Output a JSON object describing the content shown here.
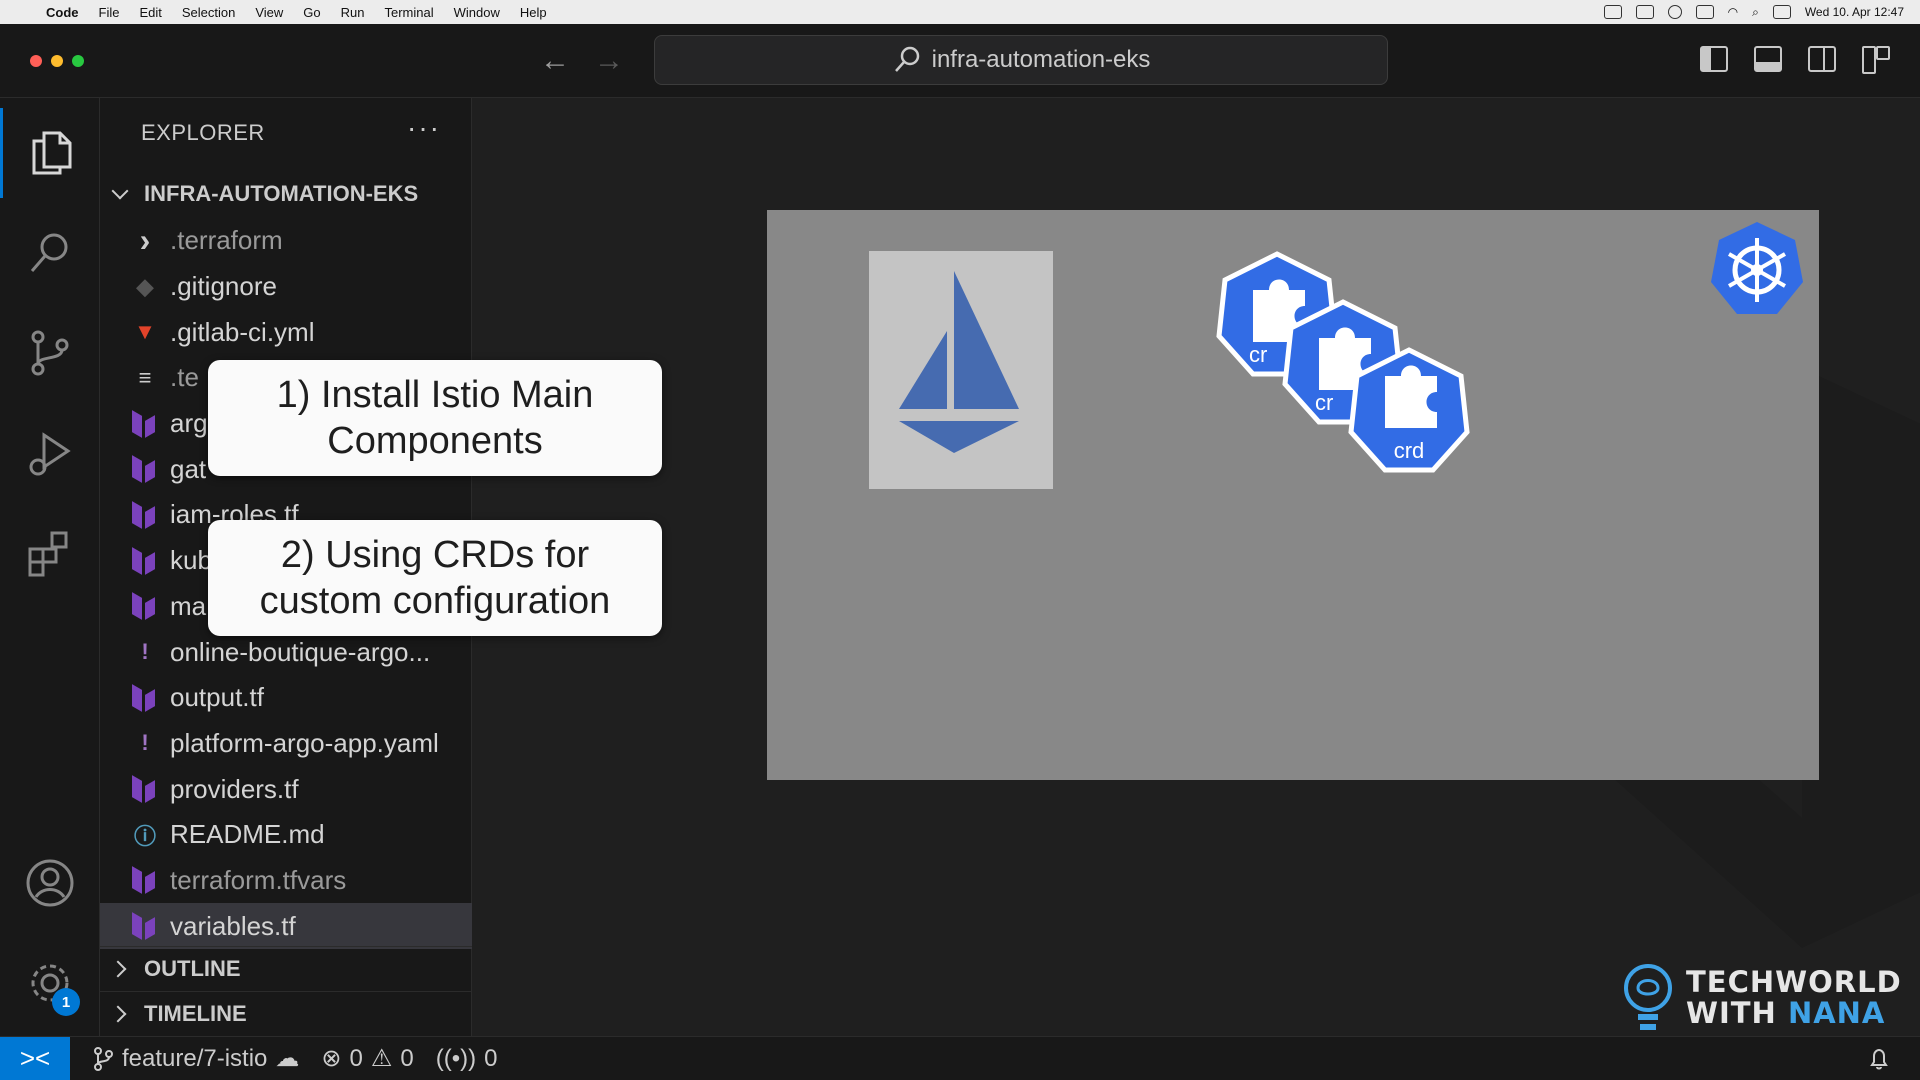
{
  "menubar": {
    "items": [
      "Code",
      "File",
      "Edit",
      "Selection",
      "View",
      "Go",
      "Run",
      "Terminal",
      "Window",
      "Help"
    ],
    "clock": "Wed 10. Apr  12:47"
  },
  "titlebar": {
    "search_text": "infra-automation-eks"
  },
  "activity": {
    "settings_badge": "1"
  },
  "explorer": {
    "title": "EXPLORER",
    "more": "···",
    "folder": "INFRA-AUTOMATION-EKS",
    "files": [
      {
        "name": ".terraform",
        "icon": "chevron-right",
        "dim": true
      },
      {
        "name": ".gitignore",
        "icon": "git-icon"
      },
      {
        "name": ".gitlab-ci.yml",
        "icon": "gitlab-icon"
      },
      {
        "name": ".te",
        "icon": "lines-icon",
        "dim": true
      },
      {
        "name": "arg",
        "icon": "terraform-icon"
      },
      {
        "name": "gat",
        "icon": "terraform-icon"
      },
      {
        "name": "iam-roles.tf",
        "icon": "terraform-icon"
      },
      {
        "name": "kub",
        "icon": "terraform-icon"
      },
      {
        "name": "ma",
        "icon": "terraform-icon"
      },
      {
        "name": "online-boutique-argo...",
        "icon": "yaml-icon"
      },
      {
        "name": "output.tf",
        "icon": "terraform-icon"
      },
      {
        "name": "platform-argo-app.yaml",
        "icon": "yaml-icon"
      },
      {
        "name": "providers.tf",
        "icon": "terraform-icon"
      },
      {
        "name": "README.md",
        "icon": "info-icon"
      },
      {
        "name": "terraform.tfvars",
        "icon": "terraform-icon",
        "dim": true
      },
      {
        "name": "variables.tf",
        "icon": "terraform-icon",
        "selected": true
      }
    ],
    "outline": "OUTLINE",
    "timeline": "TIMELINE"
  },
  "callouts": {
    "first": "1) Install Istio Main Components",
    "second": "2) Using CRDs for custom configuration"
  },
  "slide": {
    "crd_label": "crd",
    "crd_partial_1": "cr",
    "crd_partial_2": "cr"
  },
  "branding": {
    "line1": "TECHWORLD",
    "line2_a": "WITH ",
    "line2_b": "NANA"
  },
  "statusbar": {
    "branch": "feature/7-istio",
    "errors": "0",
    "warnings": "0",
    "ports": "0"
  },
  "colors": {
    "accent": "#0078d4",
    "terraform": "#7b42bc",
    "crd_blue": "#326ce5",
    "istio_blue": "#466bb0"
  }
}
